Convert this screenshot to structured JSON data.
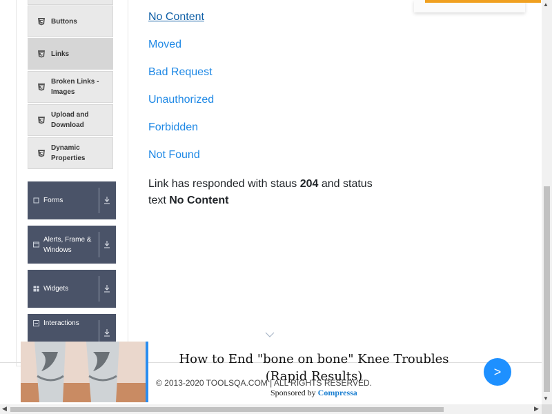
{
  "sidebar": {
    "element_items": [
      {
        "label": "Buttons",
        "icon": "html5-icon"
      },
      {
        "label": "Links",
        "icon": "html5-icon",
        "active": true
      },
      {
        "label": "Broken Links - Images",
        "icon": "html5-icon"
      },
      {
        "label": "Upload and Download",
        "icon": "html5-icon"
      },
      {
        "label": "Dynamic Properties",
        "icon": "html5-icon"
      }
    ],
    "groups": [
      {
        "label": "Forms",
        "icon": "form-icon"
      },
      {
        "label": "Alerts, Frame & Windows",
        "icon": "window-icon"
      },
      {
        "label": "Widgets",
        "icon": "widgets-icon"
      },
      {
        "label": "Interactions",
        "icon": "interactions-icon"
      }
    ]
  },
  "links": [
    "No Content",
    "Moved",
    "Bad Request",
    "Unauthorized",
    "Forbidden",
    "Not Found"
  ],
  "response": {
    "prefix": "Link has responded with staus",
    "status_code": "204",
    "middle": "and status text",
    "status_text": "No Content"
  },
  "footer": {
    "copyright": "© 2013-2020 TOOLSQA.COM | ALL RIGHTS RESERVED."
  },
  "ad": {
    "headline": "How to End \"bone on bone\" Knee Troubles (Rapid Results)",
    "sponsored_by": "Sponsored by",
    "sponsor": "Compressa",
    "arrow": ">"
  },
  "colors": {
    "link": "#1e88e5",
    "sidebar_group_bg": "#4a5368",
    "ad_arrow_bg": "#1e90ff",
    "ad_top_bar": "#f0a020"
  }
}
